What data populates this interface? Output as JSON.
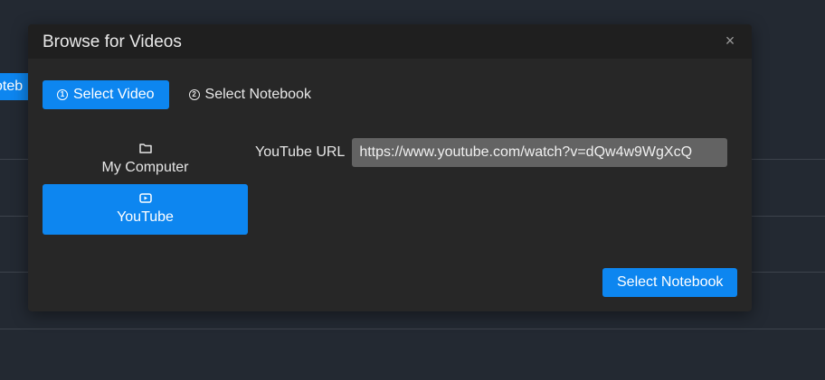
{
  "modal": {
    "title": "Browse for Videos",
    "close_glyph": "×"
  },
  "background": {
    "tab_fragment": "oteb"
  },
  "steps": [
    {
      "number": "1",
      "label": "Select Video",
      "active": true
    },
    {
      "number": "2",
      "label": "Select Notebook",
      "active": false
    }
  ],
  "sources": [
    {
      "label": "My Computer",
      "icon": "folder-icon",
      "active": false
    },
    {
      "label": "YouTube",
      "icon": "youtube-icon",
      "active": true
    }
  ],
  "youtube": {
    "label": "YouTube URL",
    "value": "https://www.youtube.com/watch?v=dQw4w9WgXcQ"
  },
  "footer": {
    "primary_label": "Select Notebook"
  },
  "colors": {
    "accent": "#0d86f0",
    "modal_bg": "#272727",
    "header_bg": "#1f1f1f",
    "page_bg": "#232932"
  }
}
